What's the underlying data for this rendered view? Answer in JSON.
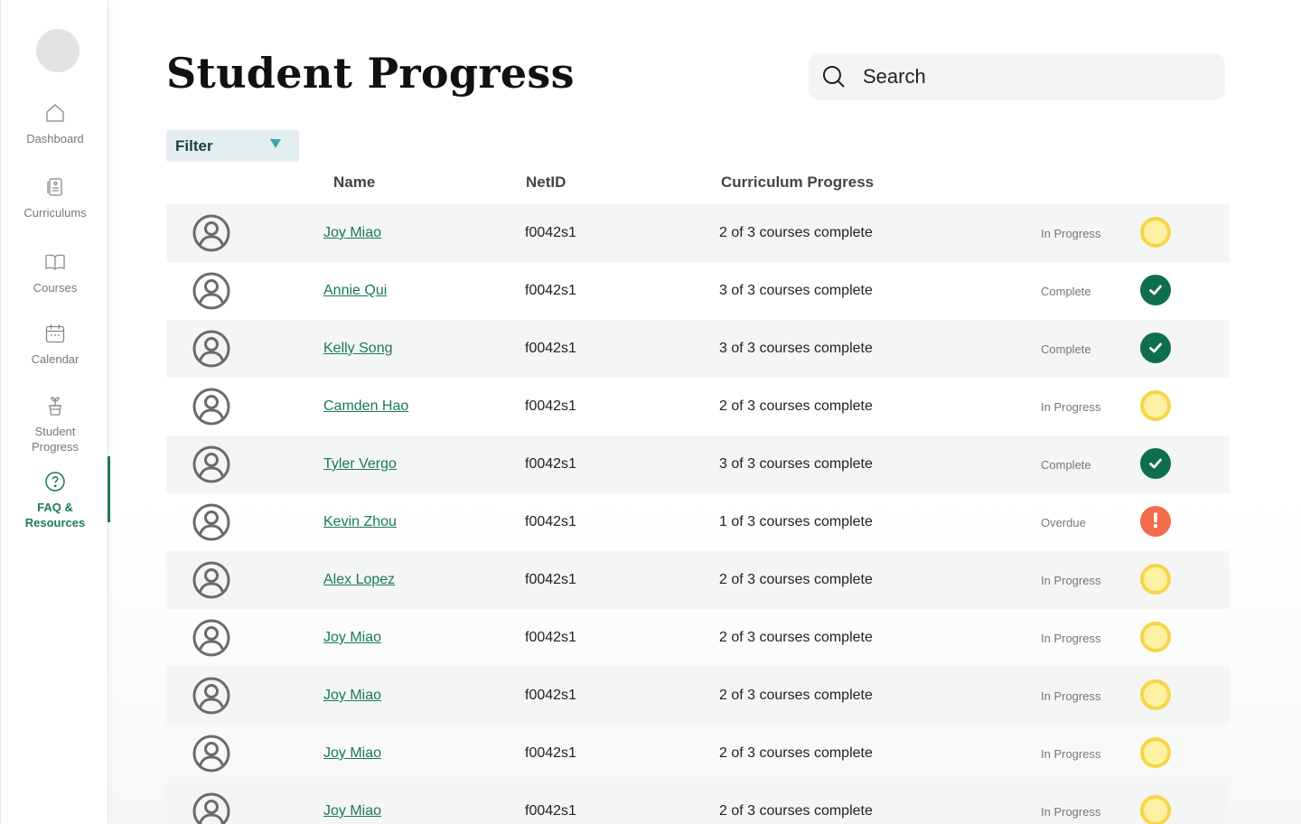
{
  "sidebar": {
    "items": [
      {
        "label": "Dashboard",
        "icon": "home-icon"
      },
      {
        "label": "Curriculums",
        "icon": "curriculum-icon"
      },
      {
        "label": "Courses",
        "icon": "book-icon"
      },
      {
        "label": "Calendar",
        "icon": "calendar-icon"
      },
      {
        "label": "Student\nProgress",
        "label_line1": "Student",
        "label_line2": "Progress",
        "icon": "plant-icon"
      },
      {
        "label": "FAQ & Resources",
        "label_line1": "FAQ &",
        "label_line2": "Resources",
        "icon": "help-icon",
        "active": true
      }
    ]
  },
  "header": {
    "title": "Student Progress",
    "search": {
      "placeholder": "Search",
      "icon": "search-icon"
    }
  },
  "filter": {
    "label": "Filter",
    "icon": "caret-down-icon"
  },
  "table": {
    "columns": {
      "name": "Name",
      "netid": "NetID",
      "progress": "Curriculum Progress"
    },
    "rows": [
      {
        "name": "Joy Miao",
        "netid": "f0042s1",
        "progress": "2 of 3 courses complete",
        "status": "In Progress",
        "state": "inprogress"
      },
      {
        "name": "Annie Qui",
        "netid": "f0042s1",
        "progress": "3 of 3 courses complete",
        "status": "Complete",
        "state": "complete"
      },
      {
        "name": "Kelly Song",
        "netid": "f0042s1",
        "progress": "3 of 3 courses complete",
        "status": "Complete",
        "state": "complete"
      },
      {
        "name": "Camden Hao",
        "netid": "f0042s1",
        "progress": "2 of 3 courses complete",
        "status": "In Progress",
        "state": "inprogress"
      },
      {
        "name": "Tyler Vergo",
        "netid": "f0042s1",
        "progress": "3 of 3 courses complete",
        "status": "Complete",
        "state": "complete"
      },
      {
        "name": "Kevin Zhou",
        "netid": "f0042s1",
        "progress": "1 of 3 courses complete",
        "status": "Overdue",
        "state": "overdue"
      },
      {
        "name": "Alex Lopez",
        "netid": "f0042s1",
        "progress": "2 of 3 courses complete",
        "status": "In Progress",
        "state": "inprogress"
      },
      {
        "name": "Joy Miao",
        "netid": "f0042s1",
        "progress": "2 of 3 courses complete",
        "status": "In Progress",
        "state": "inprogress"
      },
      {
        "name": "Joy Miao",
        "netid": "f0042s1",
        "progress": "2 of 3 courses complete",
        "status": "In Progress",
        "state": "inprogress"
      },
      {
        "name": "Joy Miao",
        "netid": "f0042s1",
        "progress": "2 of 3 courses complete",
        "status": "In Progress",
        "state": "inprogress"
      },
      {
        "name": "Joy Miao",
        "netid": "f0042s1",
        "progress": "2 of 3 courses complete",
        "status": "In Progress",
        "state": "inprogress"
      }
    ]
  },
  "colors": {
    "accent": "#1a7a56",
    "complete": "#0f6e4e",
    "in_progress": "#f6d649",
    "overdue": "#f26b4b",
    "filter_bg": "#e3eef0"
  }
}
